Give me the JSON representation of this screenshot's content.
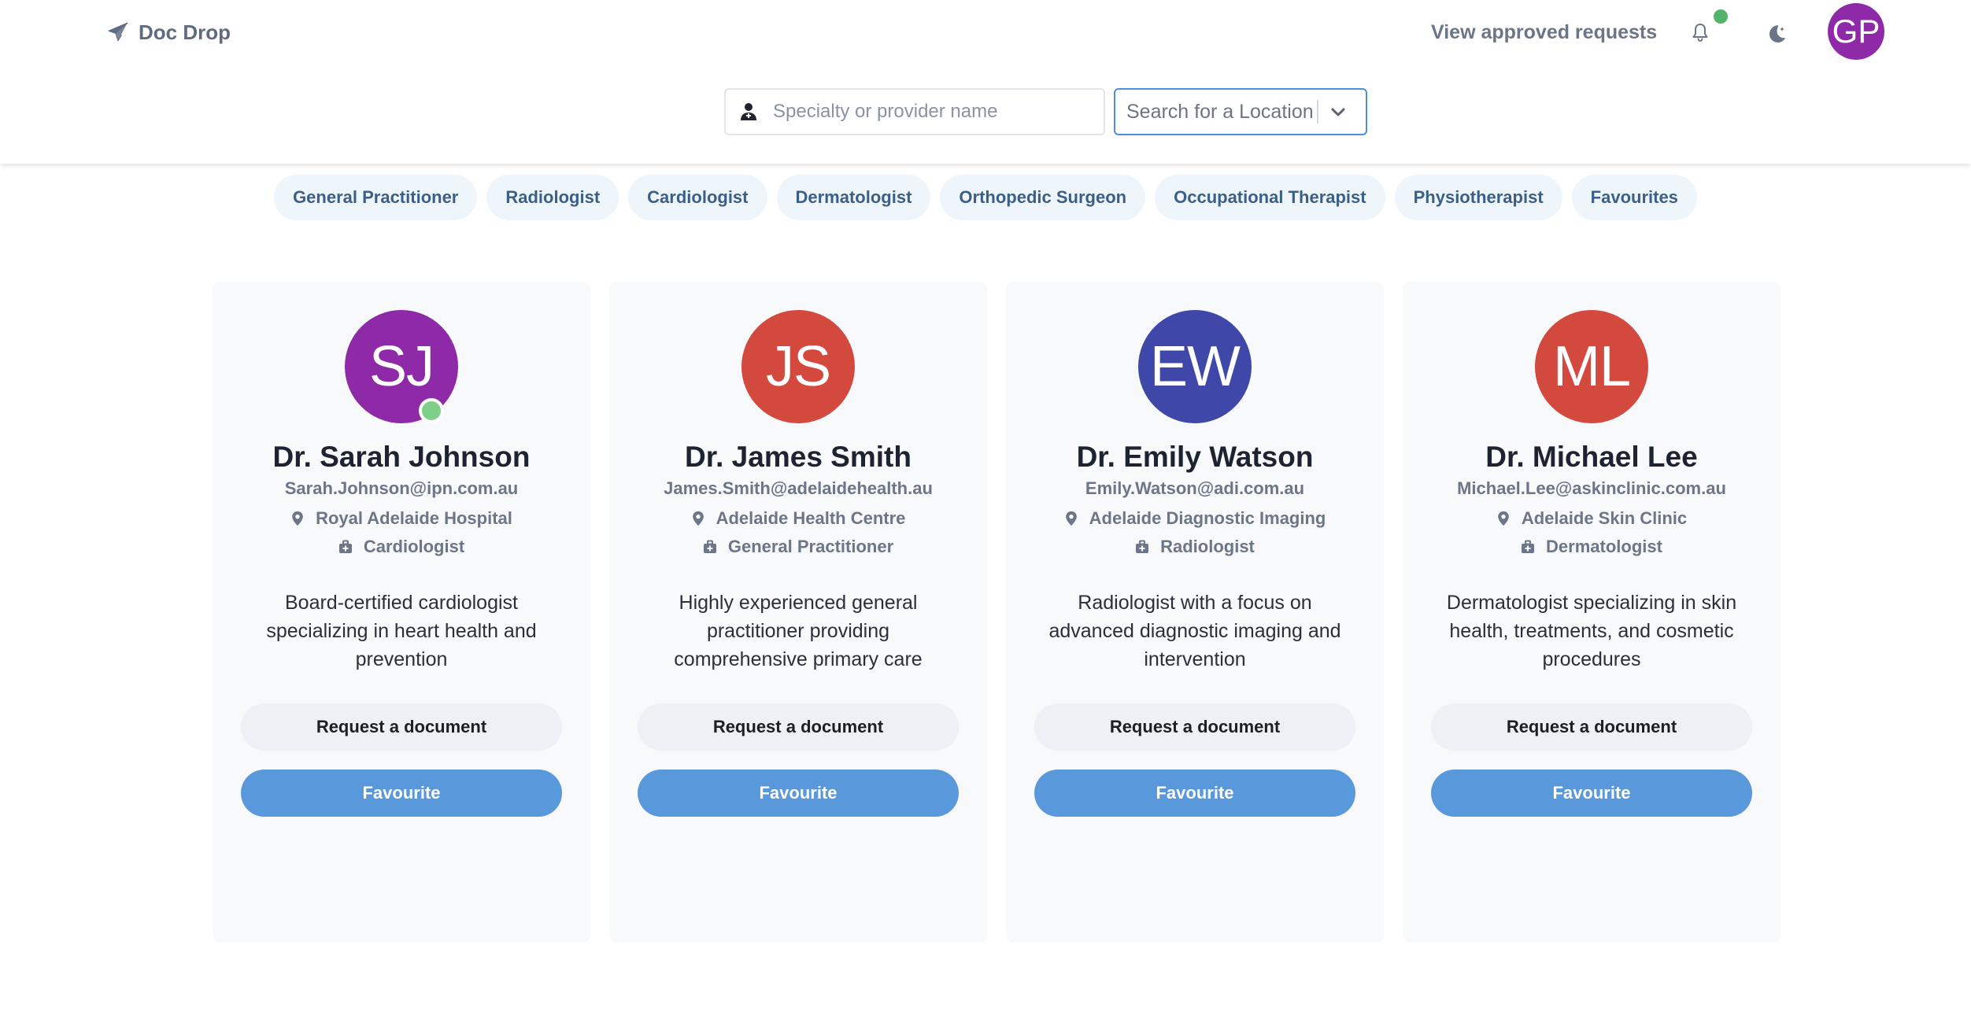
{
  "header": {
    "brand": "Doc Drop",
    "approved_link": "View approved requests",
    "user_initials": "GP",
    "user_avatar_color": "#8e2aa7",
    "notification_dot_color": "#52b36b"
  },
  "search": {
    "provider_placeholder": "Specialty or provider name",
    "location_placeholder": "Search for a Location"
  },
  "chips": [
    "General Practitioner",
    "Radiologist",
    "Cardiologist",
    "Dermatologist",
    "Orthopedic Surgeon",
    "Occupational Therapist",
    "Physiotherapist",
    "Favourites"
  ],
  "doctors": [
    {
      "initials": "SJ",
      "avatar_color": "#8e2aa7",
      "online": true,
      "name": "Dr. Sarah Johnson",
      "email": "Sarah.Johnson@ipn.com.au",
      "location": "Royal Adelaide Hospital",
      "specialty": "Cardiologist",
      "description": "Board-certified cardiologist specializing in heart health and prevention",
      "request_label": "Request a document",
      "favourite_label": "Favourite"
    },
    {
      "initials": "JS",
      "avatar_color": "#d4493e",
      "online": false,
      "name": "Dr. James Smith",
      "email": "James.Smith@adelaidehealth.au",
      "location": "Adelaide Health Centre",
      "specialty": "General Practitioner",
      "description": "Highly experienced general practitioner providing comprehensive primary care",
      "request_label": "Request a document",
      "favourite_label": "Favourite"
    },
    {
      "initials": "EW",
      "avatar_color": "#3f48a8",
      "online": false,
      "name": "Dr. Emily Watson",
      "email": "Emily.Watson@adi.com.au",
      "location": "Adelaide Diagnostic Imaging",
      "specialty": "Radiologist",
      "description": "Radiologist with a focus on advanced diagnostic imaging and intervention",
      "request_label": "Request a document",
      "favourite_label": "Favourite"
    },
    {
      "initials": "ML",
      "avatar_color": "#d4493e",
      "online": false,
      "name": "Dr. Michael Lee",
      "email": "Michael.Lee@askinclinic.com.au",
      "location": "Adelaide Skin Clinic",
      "specialty": "Dermatologist",
      "description": "Dermatologist specializing in skin health, treatments, and cosmetic procedures",
      "request_label": "Request a document",
      "favourite_label": "Favourite"
    }
  ],
  "colors": {
    "accent": "#5898db",
    "chip_bg": "#eef5fb",
    "chip_text": "#3b5f86"
  }
}
